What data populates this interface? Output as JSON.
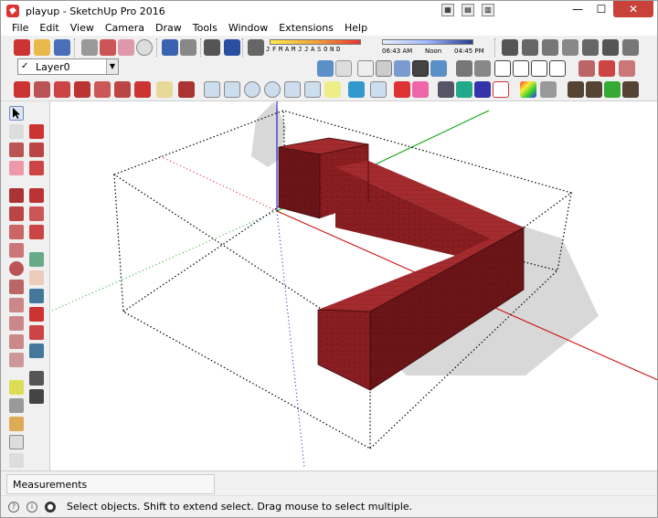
{
  "window": {
    "title": "playup - SketchUp Pro 2016",
    "minimize_label": "—",
    "maximize_label": "☐",
    "close_label": "✕"
  },
  "menubar": {
    "items": [
      "File",
      "Edit",
      "View",
      "Camera",
      "Draw",
      "Tools",
      "Window",
      "Extensions",
      "Help"
    ]
  },
  "layers": {
    "current_layer": "Layer0"
  },
  "shadows": {
    "months_label": "JFMAMJJASOND",
    "time_start": "06:43 AM",
    "time_mid": "Noon",
    "time_end": "04:45 PM"
  },
  "measurements": {
    "label": "Measurements",
    "value": ""
  },
  "status": {
    "hint": "Select objects. Shift to extend select. Drag mouse to select multiple."
  },
  "colors": {
    "brick": "#8c1f22",
    "brick_dark": "#6e1518",
    "brick_light": "#a62c2f",
    "axis_red": "#cc0000",
    "axis_green": "#00a000",
    "axis_blue": "#0000cc",
    "shadow": "#c8c8c8"
  },
  "icons": {
    "title_icon": "sketchup-logo-icon",
    "select_tool": "arrow-select-icon"
  }
}
